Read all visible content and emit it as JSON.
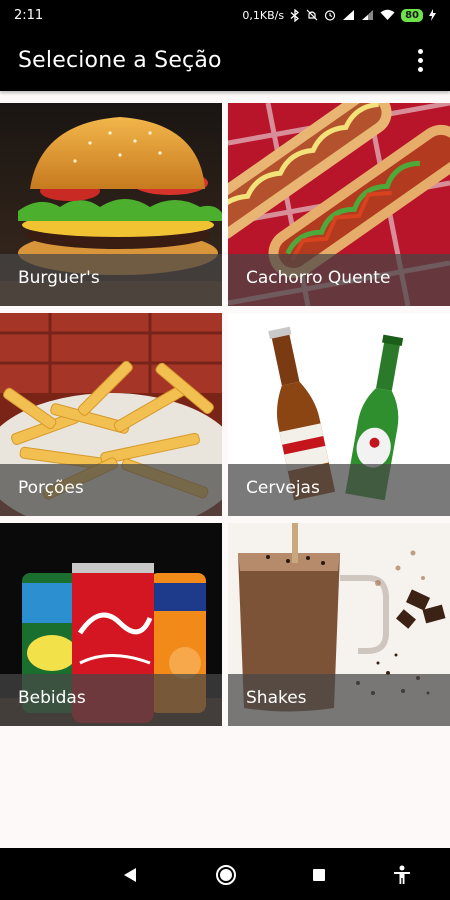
{
  "status_bar": {
    "time": "2:11",
    "network_speed": "0,1KB/s",
    "battery": "80",
    "icons": [
      "bluetooth-icon",
      "mute-icon",
      "alarm-icon",
      "signal-icon",
      "signal-icon",
      "wifi-icon",
      "battery-icon",
      "charging-icon"
    ]
  },
  "app_bar": {
    "title": "Selecione a Seção",
    "overflow_icon": "more-vert-icon"
  },
  "sections": [
    {
      "label": "Burguer's",
      "image": "burger-photo"
    },
    {
      "label": "Cachorro Quente",
      "image": "hotdog-photo"
    },
    {
      "label": "Porções",
      "image": "fries-photo"
    },
    {
      "label": "Cervejas",
      "image": "beer-bottles-photo"
    },
    {
      "label": "Bebidas",
      "image": "soda-cans-photo"
    },
    {
      "label": "Shakes",
      "image": "chocolate-shake-photo"
    }
  ],
  "nav_bar": {
    "icons": [
      "back-icon",
      "home-icon",
      "recents-icon",
      "accessibility-icon"
    ]
  },
  "colors": {
    "bar_background": "#000000",
    "page_background": "#fdf9f8",
    "label_overlay": "#464646",
    "battery": "#6ee34a"
  }
}
